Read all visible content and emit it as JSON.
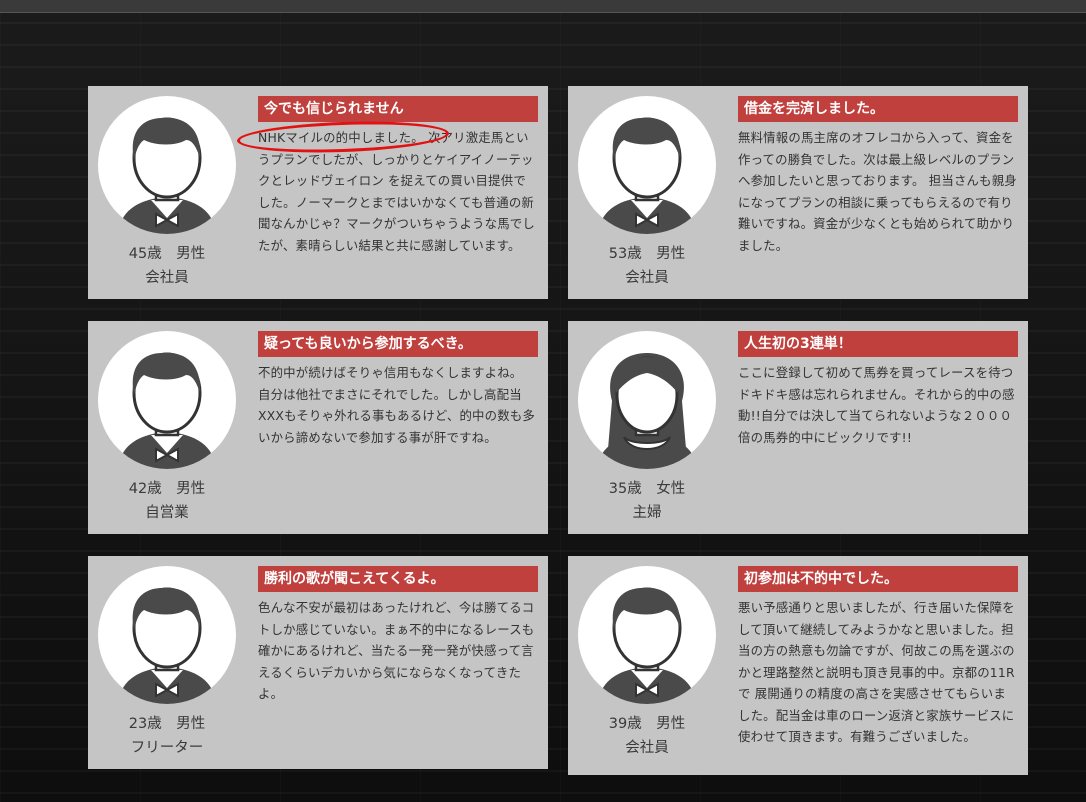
{
  "testimonials": [
    {
      "age_gender": "45歳　男性",
      "occupation": "会社員",
      "title": "今でも信じられません",
      "body": "NHKマイルの的中しました。 次アリ激走馬というプランでしたが、しっかりとケイアイノーテックとレッドヴェイロン を捉えての買い目提供でした。ノーマークとまではいかなくても普通の新聞なんかじゃ？マークがついちゃうような馬でしたが、素晴らしい結果と共に感謝しています。",
      "avatar": "male-silhouette-icon"
    },
    {
      "age_gender": "53歳　男性",
      "occupation": "会社員",
      "title": "借金を完済しました。",
      "body": "無料情報の馬主席のオフレコから入って、資金を作っての勝負でした。次は最上級レベルのプランへ参加したいと思っております。 担当さんも親身になってプランの相談に乗ってもらえるので有り難いですね。資金が少なくとも始められて助かりました。",
      "avatar": "male-silhouette-icon"
    },
    {
      "age_gender": "42歳　男性",
      "occupation": "自営業",
      "title": "疑っても良いから参加するべき。",
      "body": "不的中が続けばそりゃ信用もなくしますよね。 自分は他社でまさにそれでした。しかし高配当XXXもそりゃ外れる事もあるけど、的中の数も多いから諦めないで参加する事が肝ですね。",
      "avatar": "male-silhouette-icon"
    },
    {
      "age_gender": "35歳　女性",
      "occupation": "主婦",
      "title": "人生初の3連単！",
      "body": "ここに登録して初めて馬券を買ってレースを待つドキドキ感は忘れられません。それから的中の感動!!自分では決して当てられないような２０００倍の馬券的中にビックリです!!",
      "avatar": "female-silhouette-icon"
    },
    {
      "age_gender": "23歳　男性",
      "occupation": "フリーター",
      "title": "勝利の歌が聞こえてくるよ。",
      "body": "色んな不安が最初はあったけれど、今は勝てるコトしか感じていない。まぁ不的中になるレースも確かにあるけれど、当たる一発一発が快感って言えるくらいデカいから気にならなくなってきたよ。",
      "avatar": "male-silhouette-icon"
    },
    {
      "age_gender": "39歳　男性",
      "occupation": "会社員",
      "title": "初参加は不的中でした。",
      "body": "悪い予感通りと思いましたが、行き届いた保障をして頂いて継続してみようかなと思いました。担当の方の熱意も勿論ですが、何故この馬を選ぶのかと理路整然と説明も頂き見事的中。京都の11Rで 展開通りの精度の高さを実感させてもらいました。配当金は車のローン返済と家族サービスに使わせて頂きます。有難うございました。",
      "avatar": "male-silhouette-icon"
    }
  ],
  "colors": {
    "title_bg": "#c0403e",
    "card_bg": "#c5c5c5",
    "highlight_circle": "#e31212"
  }
}
